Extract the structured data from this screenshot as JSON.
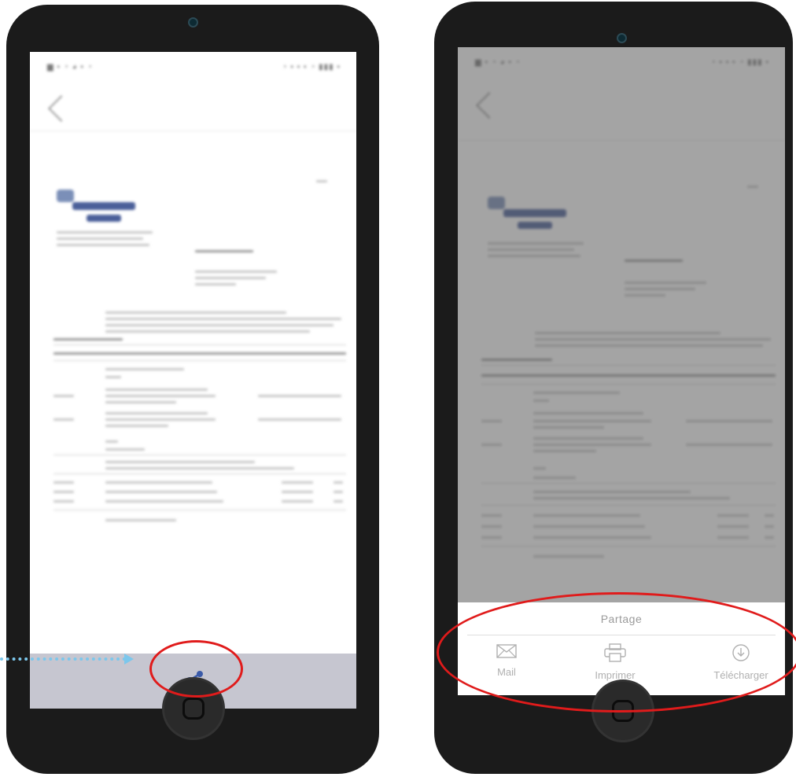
{
  "left_phone": {
    "status_left": "▆ ▪ ◔ ◕ ▪ ◔",
    "status_right": "◔ ▪ ▪ ▪ ◔ ▮▮▮ ▪"
  },
  "right_phone": {
    "status_left": "▆ ▪ ◔ ◕ ▪ ◔",
    "status_right": "◔ ▪ ▪ ▪ ◔ ▮▮▮ ▪",
    "share_sheet": {
      "title": "Partage",
      "actions": [
        {
          "label": "Mail",
          "icon": "mail-icon"
        },
        {
          "label": "Imprimer",
          "icon": "printer-icon"
        },
        {
          "label": "Télécharger",
          "icon": "download-icon"
        }
      ]
    }
  },
  "colors": {
    "phone_body": "#1b1b1b",
    "bottom_bar": "#c6c6d0",
    "share_icon": "#3a5aa8",
    "annotation_red": "#e01b1b",
    "annotation_arrow": "#7cc7ec"
  }
}
